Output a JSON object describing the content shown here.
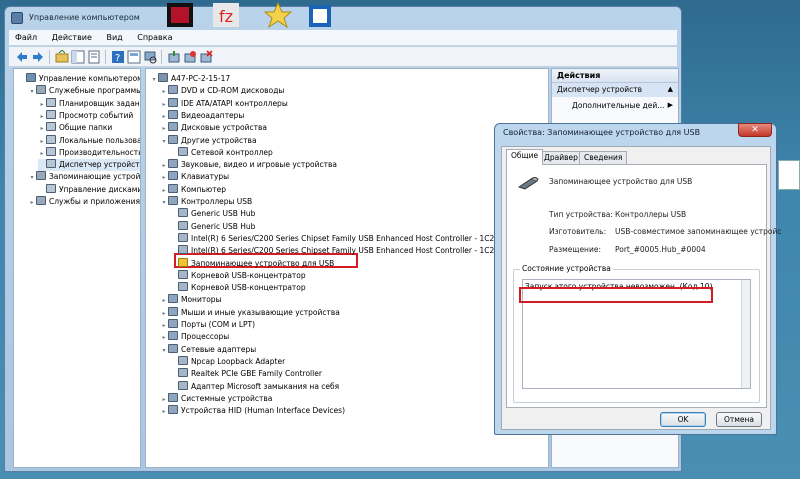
{
  "window": {
    "title": "Управление компьютером"
  },
  "menu": [
    "Файл",
    "Действие",
    "Вид",
    "Справка"
  ],
  "left_tree": [
    {
      "label": "Управление компьютером (л",
      "indent": 0,
      "expander": ""
    },
    {
      "label": "Служебные программы",
      "indent": 1,
      "expander": "▾"
    },
    {
      "label": "Планировщик заданий",
      "indent": 2,
      "expander": "▸"
    },
    {
      "label": "Просмотр событий",
      "indent": 2,
      "expander": "▸"
    },
    {
      "label": "Общие папки",
      "indent": 2,
      "expander": "▸"
    },
    {
      "label": "Локальные пользовате",
      "indent": 2,
      "expander": "▸"
    },
    {
      "label": "Производительность",
      "indent": 2,
      "expander": "▸"
    },
    {
      "label": "Диспетчер устройств",
      "indent": 2,
      "expander": "",
      "selected": true
    },
    {
      "label": "Запоминающие устройст",
      "indent": 1,
      "expander": "▾"
    },
    {
      "label": "Управление дисками",
      "indent": 2,
      "expander": ""
    },
    {
      "label": "Службы и приложения",
      "indent": 1,
      "expander": "▸"
    }
  ],
  "device_tree": [
    {
      "label": "A47-PC-2-15-17",
      "indent": 0,
      "expander": "▾"
    },
    {
      "label": "DVD и CD-ROM дисководы",
      "indent": 1,
      "expander": "▸"
    },
    {
      "label": "IDE ATA/ATAPI контроллеры",
      "indent": 1,
      "expander": "▸"
    },
    {
      "label": "Видеоадаптеры",
      "indent": 1,
      "expander": "▸"
    },
    {
      "label": "Дисковые устройства",
      "indent": 1,
      "expander": "▸"
    },
    {
      "label": "Другие устройства",
      "indent": 1,
      "expander": "▾"
    },
    {
      "label": "Сетевой контроллер",
      "indent": 2,
      "expander": ""
    },
    {
      "label": "Звуковые, видео и игровые устройства",
      "indent": 1,
      "expander": "▸"
    },
    {
      "label": "Клавиатуры",
      "indent": 1,
      "expander": "▸"
    },
    {
      "label": "Компьютер",
      "indent": 1,
      "expander": "▸"
    },
    {
      "label": "Контроллеры USB",
      "indent": 1,
      "expander": "▾"
    },
    {
      "label": "Generic USB Hub",
      "indent": 2,
      "expander": ""
    },
    {
      "label": "Generic USB Hub",
      "indent": 2,
      "expander": ""
    },
    {
      "label": "Intel(R) 6 Series/C200 Series Chipset Family USB Enhanced Host Controller - 1C26",
      "indent": 2,
      "expander": ""
    },
    {
      "label": "Intel(R) 6 Series/C200 Series Chipset Family USB Enhanced Host Controller - 1C2D",
      "indent": 2,
      "expander": ""
    },
    {
      "label": "Запоминающее устройство для USB",
      "indent": 2,
      "expander": "",
      "warning": true
    },
    {
      "label": "Корневой USB-концентратор",
      "indent": 2,
      "expander": ""
    },
    {
      "label": "Корневой USB-концентратор",
      "indent": 2,
      "expander": ""
    },
    {
      "label": "Мониторы",
      "indent": 1,
      "expander": "▸"
    },
    {
      "label": "Мыши и иные указывающие устройства",
      "indent": 1,
      "expander": "▸"
    },
    {
      "label": "Порты (COM и LPT)",
      "indent": 1,
      "expander": "▸"
    },
    {
      "label": "Процессоры",
      "indent": 1,
      "expander": "▸"
    },
    {
      "label": "Сетевые адаптеры",
      "indent": 1,
      "expander": "▾"
    },
    {
      "label": "Npcap Loopback Adapter",
      "indent": 2,
      "expander": ""
    },
    {
      "label": "Realtek PCIe GBE Family Controller",
      "indent": 2,
      "expander": ""
    },
    {
      "label": "Адаптер Microsoft замыкания на себя",
      "indent": 2,
      "expander": ""
    },
    {
      "label": "Системные устройства",
      "indent": 1,
      "expander": "▸"
    },
    {
      "label": "Устройства HID (Human Interface Devices)",
      "indent": 1,
      "expander": "▸"
    }
  ],
  "actions": {
    "header": "Действия",
    "items": [
      "Диспетчер устройств",
      "Дополнительные дей..."
    ]
  },
  "dialog": {
    "title": "Свойства: Запоминающее устройство для USB",
    "close": "✕",
    "tabs": [
      "Общие",
      "Драйвер",
      "Сведения"
    ],
    "device_name": "Запоминающее устройство для USB",
    "props": [
      {
        "label": "Тип устройства:",
        "value": "Контроллеры USB"
      },
      {
        "label": "Изготовитель:",
        "value": "USB-совместимое запоминающее устройс"
      },
      {
        "label": "Размещение:",
        "value": "Port_#0005.Hub_#0004"
      }
    ],
    "status_group": "Состояние устройства",
    "status_text": "Запуск этого устройства невозможен. (Код 10)",
    "ok": "OK",
    "cancel": "Отмена"
  },
  "colors": {
    "highlight": "#d41c24",
    "selection": "#dbe8f6",
    "window_frame": "#a9c6e2"
  }
}
